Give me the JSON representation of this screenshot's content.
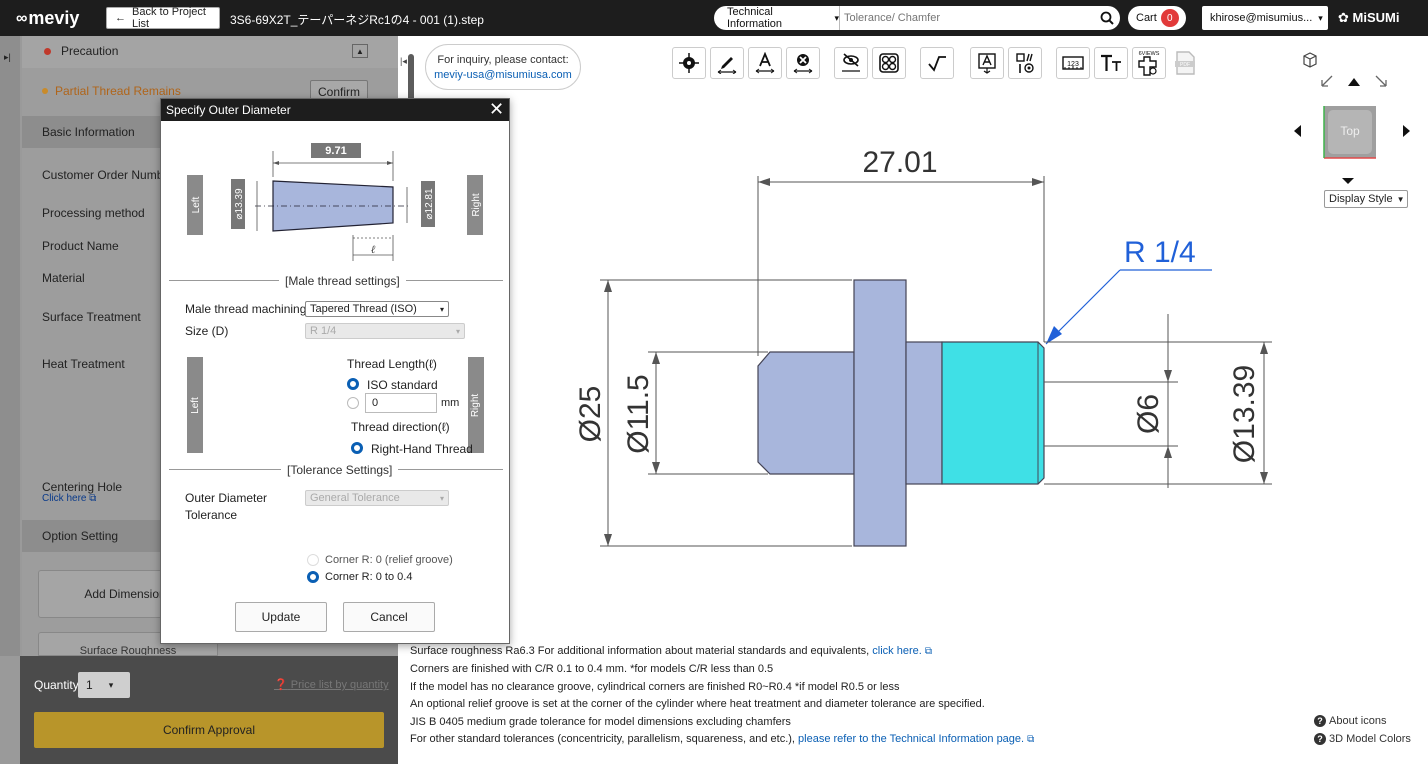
{
  "header": {
    "logo": "meviy",
    "back_label": "Back to Project List",
    "file_title": "3S6-69X2T_テーパーネジRc1の4 - 001 (1).step",
    "search_category": "Technical Information",
    "search_placeholder": "Tolerance/ Chamfer",
    "cart_label": "Cart",
    "cart_count": "0",
    "user": "khirose@misumius...",
    "brand": "MiSUMi"
  },
  "left": {
    "precaution": "Precaution",
    "partial_thread": "Partial Thread Remains",
    "confirm": "Confirm",
    "basic_info": "Basic Information",
    "fields": [
      "Customer Order Numbe",
      "Processing method",
      "Product Name",
      "Material",
      "Surface Treatment",
      "Heat Treatment"
    ],
    "centering_hole": "Centering Hole",
    "click_here": "Click here",
    "option_setting": "Option Setting",
    "add_dimensions": "Add Dimensions",
    "surface_roughness": "Surface Roughness",
    "quantity_label": "Quantity",
    "quantity_value": "1",
    "price_link": "Price list by quantity",
    "confirm_approval": "Confirm Approval"
  },
  "modal": {
    "title": "Specify Outer Diameter",
    "length_dim": "9.71",
    "left_dia": "⌀13.39",
    "right_dia": "⌀12.81",
    "left_tag": "Left",
    "right_tag": "Right",
    "ell": "ℓ",
    "male_thread_settings": "[Male thread settings]",
    "machining_label": "Male thread machining",
    "machining_value": "Tapered Thread (ISO)",
    "size_label": "Size (D)",
    "size_value": "R 1/4",
    "thread_length_label": "Thread Length(ℓ)",
    "iso_standard": "ISO standard",
    "thread_length_value": "0",
    "mm": "mm",
    "thread_direction_label": "Thread direction(ℓ)",
    "right_hand": "Right-Hand Thread",
    "tolerance_settings": "[Tolerance Settings]",
    "outer_dia_label_1": "Outer Diameter",
    "outer_dia_label_2": "Tolerance",
    "tolerance_value": "General Tolerance",
    "corner_r0": "Corner R: 0 (relief groove)",
    "corner_r04": "Corner R: 0 to 0.4",
    "update": "Update",
    "cancel": "Cancel"
  },
  "main": {
    "contact_line": "For inquiry, please contact:",
    "contact_email": "meviy-usa@misumiusa.com",
    "views_label": "6VIEWS",
    "cube_face": "Top",
    "display_style": "Display Style",
    "drawing": {
      "dim_length": "27.01",
      "thread": "R 1/4",
      "dia_25": "Ø25",
      "dia_11_5": "Ø11.5",
      "dia_6": "Ø6",
      "dia_13_39": "Ø13.39"
    },
    "notes": {
      "n1": "Surface roughness Ra6.3    For additional information about material standards and equivalents,",
      "n1_link": "click here.",
      "n2": "Corners are finished with C/R 0.1 to 0.4 mm. *for models C/R less than 0.5",
      "n3": "If the model has no clearance groove, cylindrical corners are finished R0~R0.4 *if model R0.5 or less",
      "n4": "An optional relief groove is set at the corner of the cylinder where heat treatment and diameter tolerance are specified.",
      "n5": "JIS B 0405 medium grade tolerance for model dimensions excluding chamfers",
      "n6": "For other standard tolerances (concentricity, parallelism, squareness, and etc.),",
      "n6_link": "please refer to the Technical Information page."
    },
    "about_icons": "About icons",
    "model_colors": "3D Model Colors"
  },
  "colors": {
    "header_bg": "#1d1d1d",
    "accent_blue": "#0a5fb4",
    "thread_cyan": "#3fe0e6",
    "body_blue": "#a8b6dc",
    "approve_gold": "#b8952a"
  }
}
